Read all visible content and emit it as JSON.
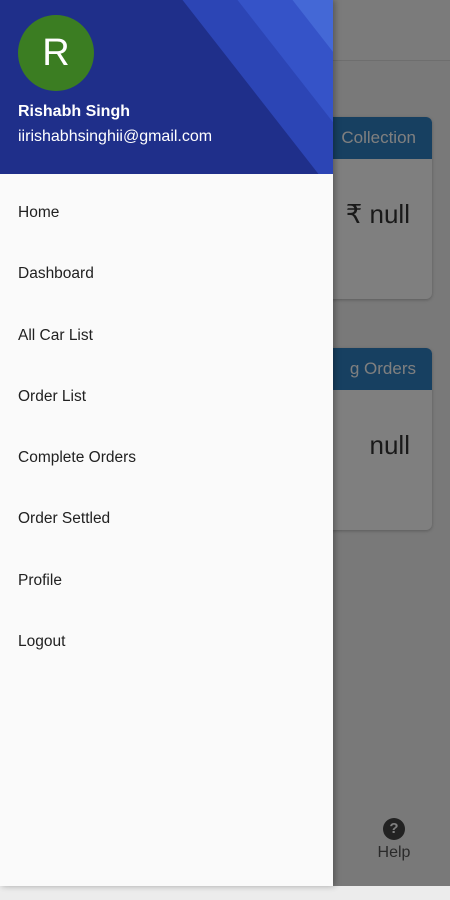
{
  "background": {
    "cards": [
      {
        "title": "Collection",
        "value": "₹ null"
      },
      {
        "title": "g Orders",
        "value": "null"
      }
    ],
    "help": {
      "label": "Help",
      "icon": "question-circle-icon"
    }
  },
  "drawer": {
    "avatar_initial": "R",
    "user_name": "Rishabh Singh",
    "user_email": "iirishabhsinghii@gmail.com",
    "menu": [
      "Home",
      "Dashboard",
      "All Car List",
      "Order List",
      "Complete Orders",
      "Order Settled",
      "Profile",
      "Logout"
    ]
  },
  "colors": {
    "header_bg": "#2c45b5",
    "avatar_bg": "#3b7d22",
    "card_title_bg": "#2f80c2"
  }
}
